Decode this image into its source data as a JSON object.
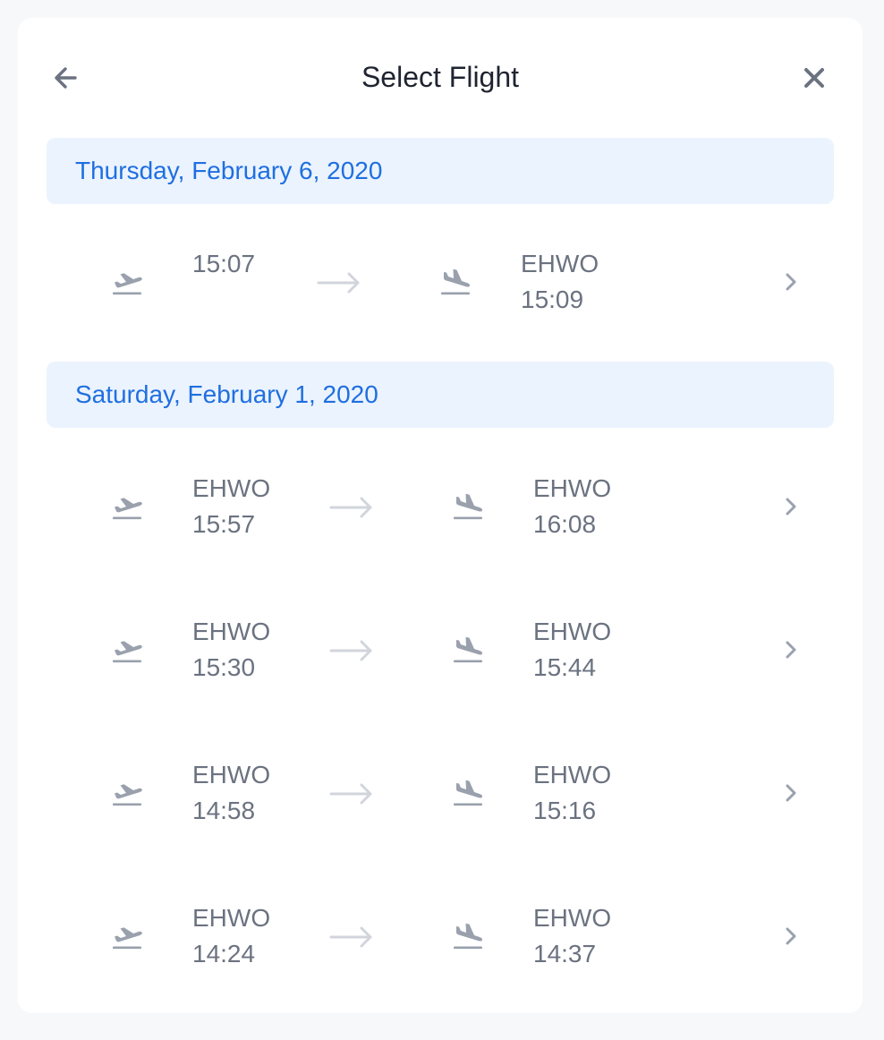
{
  "header": {
    "title": "Select Flight",
    "back_icon": "arrow-left-icon",
    "close_icon": "close-icon"
  },
  "colors": {
    "accent": "#1f6fe0",
    "date_band": "#ebf3fe",
    "muted_text": "#6b7280",
    "icon": "#9aa1ad"
  },
  "groups": [
    {
      "date": "Thursday, February 6, 2020",
      "flights": [
        {
          "dep_code": "",
          "dep_time": "15:07",
          "arr_code": "EHWO",
          "arr_time": "15:09"
        }
      ]
    },
    {
      "date": "Saturday, February 1, 2020",
      "flights": [
        {
          "dep_code": "EHWO",
          "dep_time": "15:57",
          "arr_code": "EHWO",
          "arr_time": "16:08"
        },
        {
          "dep_code": "EHWO",
          "dep_time": "15:30",
          "arr_code": "EHWO",
          "arr_time": "15:44"
        },
        {
          "dep_code": "EHWO",
          "dep_time": "14:58",
          "arr_code": "EHWO",
          "arr_time": "15:16"
        },
        {
          "dep_code": "EHWO",
          "dep_time": "14:24",
          "arr_code": "EHWO",
          "arr_time": "14:37"
        }
      ]
    }
  ]
}
